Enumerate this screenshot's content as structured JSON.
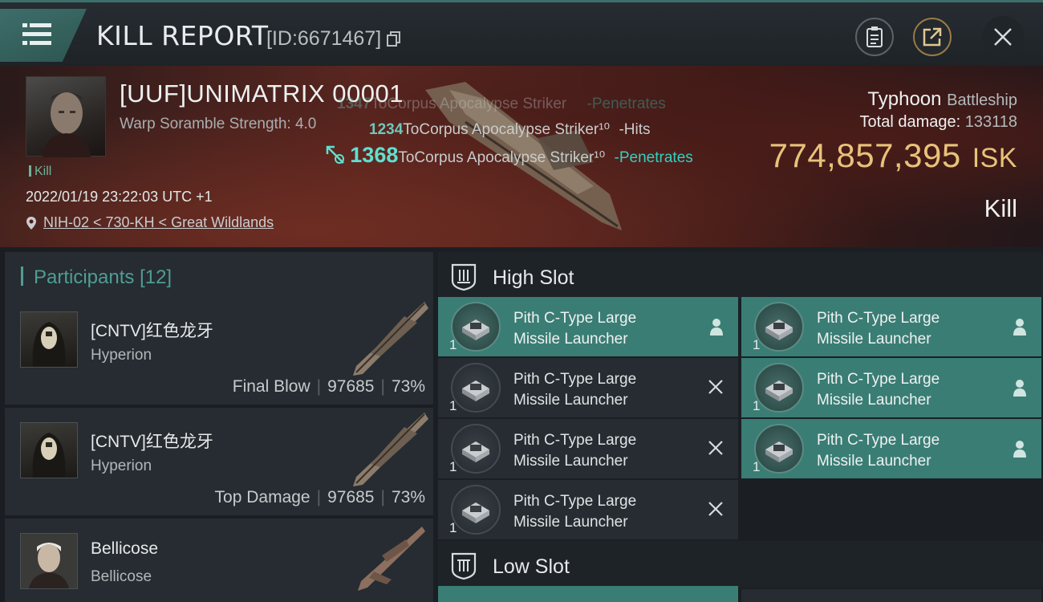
{
  "header": {
    "title": "KILL REPORT",
    "report_id": "[ID:6671467]",
    "icons": [
      "menu-icon",
      "copy-icon",
      "clipboard-icon",
      "share-icon",
      "close-icon"
    ]
  },
  "victim": {
    "name": "[UUF]UNIMATRIX 00001",
    "scramble": "Warp Soramble Strength: 4.0",
    "tag": "Kill",
    "datetime": "2022/01/19 23:22:03 UTC +1",
    "location": "NIH-02 < 730-KH < Great Wildlands"
  },
  "damage_log": [
    {
      "amount": "1347",
      "text": "ToCorpus Apocalypse Striker",
      "result": "-Penetrates"
    },
    {
      "amount": "1234",
      "text": "ToCorpus Apocalypse Striker¹⁰",
      "result": "-Hits"
    },
    {
      "amount": "1368",
      "text": "ToCorpus Apocalypse Striker¹⁰",
      "result": "-Penetrates"
    }
  ],
  "ship": {
    "name": "Typhoon",
    "class": "Battleship",
    "total_damage_label": "Total damage:",
    "total_damage_value": "133118",
    "value": "774,857,395",
    "currency": "ISK",
    "result": "Kill"
  },
  "participants": {
    "label": "Participants",
    "count": "[12]",
    "rows": [
      {
        "name": "[CNTV]红色龙牙",
        "ship": "Hyperion",
        "role": "Final Blow",
        "damage": "97685",
        "percent": "73%"
      },
      {
        "name": "[CNTV]红色龙牙",
        "ship": "Hyperion",
        "role": "Top Damage",
        "damage": "97685",
        "percent": "73%"
      },
      {
        "name": "Bellicose",
        "ship": "Bellicose",
        "role": "",
        "damage": "",
        "percent": ""
      }
    ]
  },
  "slots": {
    "high_label": "High Slot",
    "low_label": "Low Slot",
    "high_items": [
      {
        "line1": "Pith C-Type Large",
        "line2": "Missile Launcher",
        "qty": "1",
        "state": "dropped"
      },
      {
        "line1": "Pith C-Type Large",
        "line2": "Missile Launcher",
        "qty": "1",
        "state": "dropped"
      },
      {
        "line1": "Pith C-Type Large",
        "line2": "Missile Launcher",
        "qty": "1",
        "state": "destroyed"
      },
      {
        "line1": "Pith C-Type Large",
        "line2": "Missile Launcher",
        "qty": "1",
        "state": "dropped"
      },
      {
        "line1": "Pith C-Type Large",
        "line2": "Missile Launcher",
        "qty": "1",
        "state": "destroyed"
      },
      {
        "line1": "Pith C-Type Large",
        "line2": "Missile Launcher",
        "qty": "1",
        "state": "dropped"
      },
      {
        "line1": "Pith C-Type Large",
        "line2": "Missile Launcher",
        "qty": "1",
        "state": "destroyed"
      }
    ]
  },
  "colors": {
    "accent": "#3a7d74",
    "isk_gold": "#e8c27a",
    "penetrates": "#34d0c0"
  }
}
